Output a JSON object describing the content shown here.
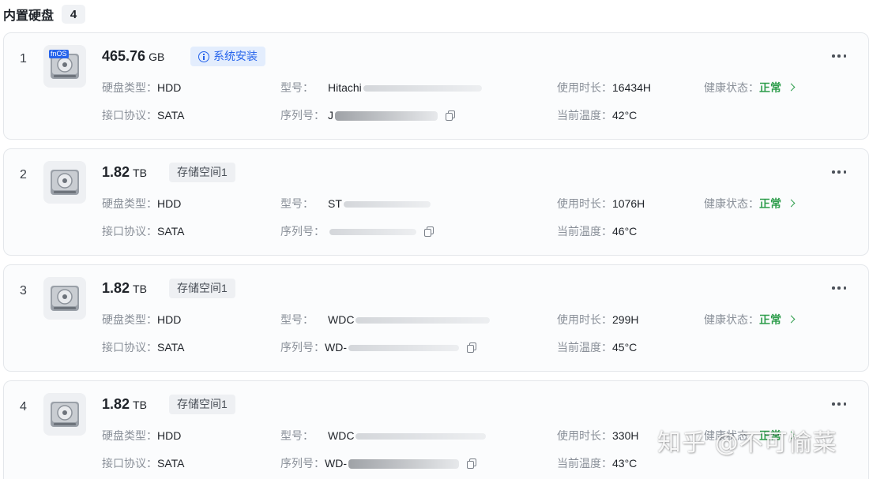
{
  "header": {
    "title": "内置硬盘",
    "count": "4"
  },
  "disks": [
    {
      "index": "1",
      "capacity": "465.76",
      "unit": "GB",
      "tag": "系统安装",
      "tag_style": "info",
      "os_badge": "fnOS",
      "type_label": "硬盘类型：",
      "type": "HDD",
      "interface_label": "接口协议：",
      "interface": "SATA",
      "model_label": "型号：",
      "model": "Hitachi",
      "serial_label": "序列号：",
      "serial": "J",
      "hours_label": "使用时长：",
      "hours": "16434H",
      "temp_label": "当前温度：",
      "temp": "42°C",
      "health_label": "健康状态：",
      "health": "正常"
    },
    {
      "index": "2",
      "capacity": "1.82",
      "unit": "TB",
      "tag": "存储空间1",
      "tag_style": "gray",
      "type_label": "硬盘类型：",
      "type": "HDD",
      "interface_label": "接口协议：",
      "interface": "SATA",
      "model_label": "型号：",
      "model": "ST",
      "serial_label": "序列号：",
      "serial": "",
      "hours_label": "使用时长：",
      "hours": "1076H",
      "temp_label": "当前温度：",
      "temp": "46°C",
      "health_label": "健康状态：",
      "health": "正常"
    },
    {
      "index": "3",
      "capacity": "1.82",
      "unit": "TB",
      "tag": "存储空间1",
      "tag_style": "gray",
      "type_label": "硬盘类型：",
      "type": "HDD",
      "interface_label": "接口协议：",
      "interface": "SATA",
      "model_label": "型号：",
      "model": "WDC",
      "serial_label": "序列号：",
      "serial": "WD-",
      "hours_label": "使用时长：",
      "hours": "299H",
      "temp_label": "当前温度：",
      "temp": "45°C",
      "health_label": "健康状态：",
      "health": "正常"
    },
    {
      "index": "4",
      "capacity": "1.82",
      "unit": "TB",
      "tag": "存储空间1",
      "tag_style": "gray",
      "type_label": "硬盘类型：",
      "type": "HDD",
      "interface_label": "接口协议：",
      "interface": "SATA",
      "model_label": "型号：",
      "model": "WDC",
      "serial_label": "序列号：",
      "serial": "WD-",
      "hours_label": "使用时长：",
      "hours": "330H",
      "temp_label": "当前温度：",
      "temp": "43°C",
      "health_label": "健康状态：",
      "health": "正常"
    }
  ],
  "watermark": "知乎 @不可愉菜",
  "colors": {
    "accent": "#2563eb",
    "health_ok": "#2e9d4c",
    "card_bg": "#fbfcfd"
  },
  "icons": [
    "hdd-icon",
    "info-icon",
    "copy-icon",
    "chevron-right-icon",
    "more-icon"
  ]
}
